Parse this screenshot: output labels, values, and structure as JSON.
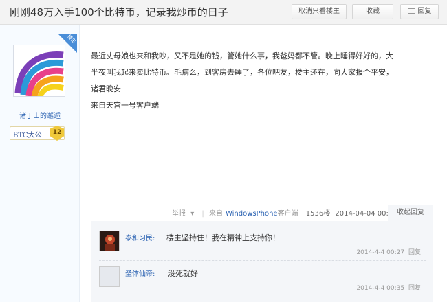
{
  "thread": {
    "title": "刚刚48万入手100个比特币，记录我炒币的日子",
    "buttons": {
      "only_host": "取消只看楼主",
      "collect": "收藏",
      "reply": "回复"
    }
  },
  "author": {
    "host_badge": "楼主",
    "name": "诸丁山的邂逅",
    "level_title": "BTC大公",
    "level": "12"
  },
  "post": {
    "lines": [
      "最近丈母娘也来和我吵，又不是她的钱，管她什么事，我爸妈都不管。晚上睡得好好的，大",
      "半夜叫我起来卖比特币。毛病么，到客房去睡了，各位吧友，楼主还在，向大家报个平安，",
      "诸君晚安",
      "来自天宫一号客户端"
    ]
  },
  "meta": {
    "report": "举报",
    "client_prefix": "来自",
    "client_name": "WindowsPhone",
    "client_suffix": "客户端",
    "floor": "1536楼",
    "time": "2014-04-04 00:23",
    "collapse_reply": "收起回复"
  },
  "replies": [
    {
      "author": "泰和习民:",
      "text": "楼主坚持住！我在精神上支持你！",
      "time": "2014-4-4 00:27",
      "reply_label": "回复"
    },
    {
      "author": "圣体仙帝:",
      "text": "没死就好",
      "time": "2014-4-4 00:35",
      "reply_label": "回复"
    }
  ],
  "colors": {
    "link_blue": "#2d64b3",
    "badge_blue": "#4a8ed8",
    "level_gold": "#f0c93a"
  },
  "icons": {
    "reply": "speech-bubble-icon",
    "report": "chevron-down-icon"
  }
}
